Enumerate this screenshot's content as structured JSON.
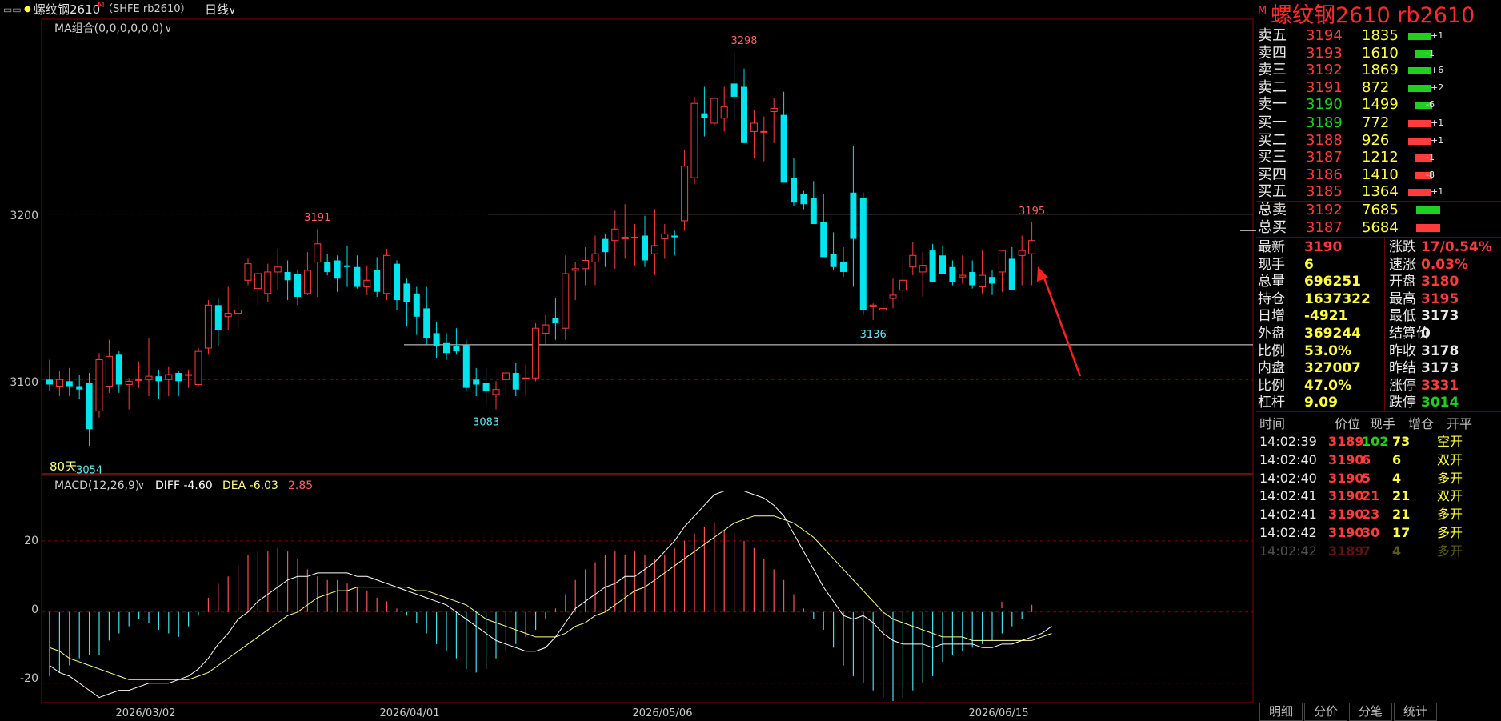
{
  "header": {
    "symbol_name": "螺纹钢2610",
    "m_badge": "M",
    "exchange_code": "（SHFE rb2610）",
    "period": "日线",
    "ma_label": "MA组合(0,0,0,0,0,0)",
    "days_label": "80天"
  },
  "macd": {
    "label": "MACD(12,26,9)",
    "diff": "DIFF -4.60",
    "dea": "DEA -6.03",
    "macd_value": "2.85"
  },
  "colors": {
    "up": "#ff3b3b",
    "down": "#00e5ee",
    "grid": "#8b0000",
    "diff_line": "#ffffff",
    "dea_line": "#ffff90"
  },
  "chart_data": {
    "type": "candlestick",
    "price_axis_ticks": [
      "3200",
      "3100"
    ],
    "price_range": [
      3044,
      3315
    ],
    "macd_axis_ticks": [
      "20",
      "0",
      "-20"
    ],
    "macd_range": [
      -25,
      33
    ],
    "date_labels": [
      "2026/03/02",
      "2026/04/01",
      "2026/05/06",
      "2026/06/15"
    ],
    "annotations": [
      "3191",
      "3298",
      "3195",
      "3083",
      "3136",
      "3054"
    ],
    "support_resistance": [
      3200,
      3121
    ],
    "candles": [
      [
        3100,
        3112,
        3093,
        3097
      ],
      [
        3096,
        3105,
        3090,
        3100
      ],
      [
        3099,
        3107,
        3090,
        3096
      ],
      [
        3096,
        3103,
        3088,
        3094
      ],
      [
        3098,
        3104,
        3060,
        3070
      ],
      [
        3081,
        3116,
        3077,
        3112
      ],
      [
        3096,
        3124,
        3092,
        3114
      ],
      [
        3115,
        3117,
        3092,
        3097
      ],
      [
        3097,
        3101,
        3082,
        3099
      ],
      [
        3100,
        3111,
        3095,
        3100
      ],
      [
        3100,
        3125,
        3090,
        3102
      ],
      [
        3102,
        3106,
        3088,
        3099
      ],
      [
        3100,
        3108,
        3090,
        3103
      ],
      [
        3104,
        3105,
        3090,
        3099
      ],
      [
        3103,
        3106,
        3095,
        3103
      ],
      [
        3097,
        3119,
        3096,
        3117
      ],
      [
        3119,
        3148,
        3115,
        3145
      ],
      [
        3145,
        3149,
        3120,
        3130
      ],
      [
        3138,
        3156,
        3130,
        3140
      ],
      [
        3140,
        3150,
        3131,
        3142
      ],
      [
        3160,
        3173,
        3157,
        3170
      ],
      [
        3155,
        3167,
        3144,
        3164
      ],
      [
        3152,
        3170,
        3147,
        3165
      ],
      [
        3165,
        3179,
        3154,
        3168
      ],
      [
        3165,
        3172,
        3148,
        3160
      ],
      [
        3164,
        3166,
        3145,
        3150
      ],
      [
        3152,
        3177,
        3151,
        3166
      ],
      [
        3171,
        3191,
        3150,
        3182
      ],
      [
        3171,
        3176,
        3163,
        3165
      ],
      [
        3172,
        3175,
        3153,
        3161
      ],
      [
        3169,
        3181,
        3156,
        3168
      ],
      [
        3168,
        3175,
        3155,
        3156
      ],
      [
        3156,
        3169,
        3151,
        3160
      ],
      [
        3166,
        3174,
        3150,
        3153
      ],
      [
        3152,
        3179,
        3148,
        3175
      ],
      [
        3170,
        3172,
        3142,
        3148
      ],
      [
        3158,
        3161,
        3132,
        3147
      ],
      [
        3152,
        3156,
        3127,
        3138
      ],
      [
        3143,
        3156,
        3121,
        3125
      ],
      [
        3128,
        3135,
        3113,
        3120
      ],
      [
        3122,
        3128,
        3112,
        3116
      ],
      [
        3120,
        3131,
        3115,
        3117
      ],
      [
        3121,
        3124,
        3093,
        3095
      ],
      [
        3100,
        3107,
        3090,
        3097
      ],
      [
        3098,
        3107,
        3085,
        3093
      ],
      [
        3091,
        3099,
        3082,
        3094
      ],
      [
        3100,
        3106,
        3090,
        3104
      ],
      [
        3104,
        3110,
        3090,
        3094
      ],
      [
        3101,
        3109,
        3091,
        3101
      ],
      [
        3101,
        3134,
        3099,
        3131
      ],
      [
        3128,
        3139,
        3121,
        3133
      ],
      [
        3137,
        3149,
        3124,
        3134
      ],
      [
        3131,
        3175,
        3124,
        3164
      ],
      [
        3166,
        3171,
        3148,
        3167
      ],
      [
        3167,
        3180,
        3157,
        3172
      ],
      [
        3171,
        3187,
        3157,
        3176
      ],
      [
        3185,
        3188,
        3168,
        3177
      ],
      [
        3184,
        3202,
        3167,
        3191
      ],
      [
        3185,
        3206,
        3173,
        3186
      ],
      [
        3186,
        3194,
        3169,
        3186
      ],
      [
        3187,
        3199,
        3168,
        3172
      ],
      [
        3176,
        3203,
        3163,
        3181
      ],
      [
        3185,
        3194,
        3173,
        3188
      ],
      [
        3187,
        3190,
        3175,
        3186
      ],
      [
        3196,
        3239,
        3190,
        3229
      ],
      [
        3222,
        3271,
        3218,
        3267
      ],
      [
        3261,
        3277,
        3247,
        3258
      ],
      [
        3255,
        3271,
        3253,
        3270
      ],
      [
        3258,
        3277,
        3250,
        3265
      ],
      [
        3279,
        3298,
        3256,
        3271
      ],
      [
        3277,
        3288,
        3245,
        3243
      ],
      [
        3250,
        3263,
        3234,
        3255
      ],
      [
        3250,
        3259,
        3232,
        3250
      ],
      [
        3262,
        3270,
        3243,
        3264
      ],
      [
        3260,
        3274,
        3232,
        3219
      ],
      [
        3222,
        3234,
        3205,
        3207
      ],
      [
        3212,
        3214,
        3203,
        3206
      ],
      [
        3210,
        3220,
        3194,
        3194
      ],
      [
        3195,
        3212,
        3187,
        3174
      ],
      [
        3176,
        3189,
        3166,
        3168
      ],
      [
        3171,
        3180,
        3162,
        3165
      ],
      [
        3213,
        3241,
        3156,
        3185
      ],
      [
        3210,
        3213,
        3139,
        3142
      ],
      [
        3144,
        3146,
        3136,
        3145
      ],
      [
        3142,
        3149,
        3138,
        3143
      ],
      [
        3149,
        3161,
        3143,
        3151
      ],
      [
        3154,
        3173,
        3147,
        3160
      ],
      [
        3168,
        3183,
        3163,
        3175
      ],
      [
        3165,
        3177,
        3150,
        3169
      ],
      [
        3178,
        3182,
        3159,
        3159
      ],
      [
        3175,
        3181,
        3164,
        3164
      ],
      [
        3168,
        3172,
        3157,
        3159
      ],
      [
        3162,
        3175,
        3158,
        3163
      ],
      [
        3165,
        3172,
        3155,
        3157
      ],
      [
        3156,
        3178,
        3152,
        3163
      ],
      [
        3162,
        3166,
        3151,
        3158
      ],
      [
        3165,
        3178,
        3153,
        3178
      ],
      [
        3173,
        3180,
        3158,
        3154
      ],
      [
        3175,
        3187,
        3157,
        3178
      ],
      [
        3176,
        3195,
        3157,
        3184
      ]
    ],
    "macd_hist": [
      -18,
      -17,
      -15,
      -13,
      -12,
      -12,
      -8,
      -6,
      -4,
      -2,
      -3,
      -5,
      -6,
      -7,
      -4,
      -1,
      4,
      8,
      10,
      13,
      16,
      17,
      17,
      18,
      17,
      15,
      12,
      10,
      9,
      9,
      8,
      7,
      6,
      4,
      3,
      1,
      -1,
      -3,
      -6,
      -9,
      -11,
      -13,
      -16,
      -17,
      -16,
      -13,
      -11,
      -9,
      -7,
      -5,
      -2,
      1,
      5,
      9,
      12,
      14,
      16,
      17,
      16,
      17,
      16,
      15,
      16,
      18,
      20,
      22,
      24,
      25,
      23,
      22,
      20,
      18,
      15,
      12,
      9,
      5,
      1,
      -2,
      -5,
      -10,
      -15,
      -18,
      -20,
      -22,
      -24,
      -25,
      -24,
      -22,
      -20,
      -18,
      -14,
      -12,
      -11,
      -10,
      -9,
      -8,
      -6,
      -4,
      -2,
      2
    ],
    "diff_line": [
      -15,
      -17,
      -18,
      -20,
      -22,
      -24,
      -23,
      -22,
      -22,
      -21,
      -20,
      -20,
      -20,
      -19,
      -18,
      -16,
      -13,
      -9,
      -6,
      -2,
      0,
      3,
      5,
      7,
      9,
      10,
      10,
      11,
      11,
      11,
      11,
      10,
      10,
      9,
      8,
      7,
      6,
      5,
      4,
      3,
      2,
      0,
      -2,
      -4,
      -6,
      -8,
      -9,
      -10,
      -11,
      -11,
      -10,
      -7,
      -3,
      1,
      3,
      5,
      7,
      8,
      10,
      10,
      12,
      14,
      17,
      20,
      24,
      27,
      30,
      33,
      34,
      34,
      34,
      33,
      32,
      30,
      27,
      22,
      17,
      12,
      7,
      3,
      -1,
      -2,
      -1,
      -3,
      -6,
      -8,
      -9,
      -9,
      -9,
      -10,
      -9,
      -9,
      -9,
      -9,
      -10,
      -10,
      -9,
      -9,
      -8,
      -7,
      -6,
      -4
    ],
    "dea_line": [
      -10,
      -11,
      -13,
      -14,
      -15,
      -16,
      -17,
      -18,
      -19,
      -19,
      -19,
      -19,
      -19,
      -19,
      -19,
      -18,
      -17,
      -15,
      -13,
      -11,
      -9,
      -7,
      -5,
      -3,
      -1,
      0,
      2,
      4,
      5,
      6,
      6,
      7,
      7,
      7,
      7,
      7,
      7,
      6,
      6,
      5,
      4,
      3,
      2,
      0,
      -2,
      -3,
      -4,
      -5,
      -6,
      -7,
      -7,
      -7,
      -6,
      -4,
      -3,
      -1,
      0,
      2,
      4,
      6,
      7,
      9,
      11,
      13,
      15,
      17,
      19,
      21,
      23,
      25,
      26,
      27,
      27,
      27,
      26,
      25,
      23,
      21,
      18,
      15,
      12,
      9,
      6,
      3,
      0,
      -2,
      -3,
      -4,
      -5,
      -6,
      -7,
      -7,
      -7,
      -8,
      -8,
      -8,
      -8,
      -8,
      -8,
      -8,
      -7,
      -6
    ]
  },
  "right_panel": {
    "title": "螺纹钢2610  rb2610",
    "m_badge": "M",
    "asks": [
      {
        "label": "卖五",
        "price": "3194",
        "vol": "1835",
        "chg": "+1",
        "up": true
      },
      {
        "label": "卖四",
        "price": "3193",
        "vol": "1610",
        "chg": "-1",
        "up": false
      },
      {
        "label": "卖三",
        "price": "3192",
        "vol": "1869",
        "chg": "+6",
        "up": true
      },
      {
        "label": "卖二",
        "price": "3191",
        "vol": "872",
        "chg": "+2",
        "up": true
      },
      {
        "label": "卖一",
        "price": "3190",
        "vol": "1499",
        "chg": "-6",
        "up": false
      }
    ],
    "bids": [
      {
        "label": "买一",
        "price": "3189",
        "vol": "772",
        "chg": "+1",
        "up": true
      },
      {
        "label": "买二",
        "price": "3188",
        "vol": "926",
        "chg": "+1",
        "up": true
      },
      {
        "label": "买三",
        "price": "3187",
        "vol": "1212",
        "chg": "-1",
        "up": false
      },
      {
        "label": "买四",
        "price": "3186",
        "vol": "1410",
        "chg": "-8",
        "up": false
      },
      {
        "label": "买五",
        "price": "3185",
        "vol": "1364",
        "chg": "+1",
        "up": true
      }
    ],
    "totals": [
      {
        "label": "总卖",
        "price": "3192",
        "vol": "7685"
      },
      {
        "label": "总买",
        "price": "3187",
        "vol": "5684"
      }
    ],
    "quote": [
      {
        "l1": "最新",
        "v1": "3190",
        "c1": "red",
        "l2": "涨跌",
        "v2": "17/0.54%",
        "c2": "red"
      },
      {
        "l1": "现手",
        "v1": "6",
        "c1": "yellow",
        "l2": "速涨",
        "v2": "0.03%",
        "c2": "red"
      },
      {
        "l1": "总量",
        "v1": "696251",
        "c1": "yellow",
        "l2": "开盘",
        "v2": "3180",
        "c2": "red"
      },
      {
        "l1": "持仓",
        "v1": "1637322",
        "c1": "yellow",
        "l2": "最高",
        "v2": "3195",
        "c2": "red"
      },
      {
        "l1": "日增",
        "v1": "-4921",
        "c1": "yellow",
        "l2": "最低",
        "v2": "3173",
        "c2": "white"
      },
      {
        "l1": "外盘",
        "v1": "369244",
        "c1": "yellow",
        "l2": "结算价",
        "v2": "0",
        "c2": "white"
      },
      {
        "l1": "比例",
        "v1": "53.0%",
        "c1": "yellow",
        "l2": "昨收",
        "v2": "3178",
        "c2": "white"
      },
      {
        "l1": "内盘",
        "v1": "327007",
        "c1": "yellow",
        "l2": "昨结",
        "v2": "3173",
        "c2": "white"
      },
      {
        "l1": "比例",
        "v1": "47.0%",
        "c1": "yellow",
        "l2": "涨停",
        "v2": "3331",
        "c2": "red"
      },
      {
        "l1": "杠杆",
        "v1": "9.09",
        "c1": "yellow",
        "l2": "跌停",
        "v2": "3014",
        "c2": "green"
      }
    ],
    "ticks_header": [
      "时间",
      "价位",
      "现手",
      "增仓",
      "开平"
    ],
    "ticks": [
      {
        "time": "14:02:39",
        "price": "3189",
        "vol": "102",
        "vc": "green",
        "oi": "73",
        "type": "空开"
      },
      {
        "time": "14:02:40",
        "price": "3190",
        "vol": "6",
        "vc": "red",
        "oi": "6",
        "type": "双开"
      },
      {
        "time": "14:02:40",
        "price": "3190",
        "vol": "5",
        "vc": "red",
        "oi": "4",
        "type": "多开"
      },
      {
        "time": "14:02:41",
        "price": "3190",
        "vol": "21",
        "vc": "red",
        "oi": "21",
        "type": "双开"
      },
      {
        "time": "14:02:41",
        "price": "3190",
        "vol": "23",
        "vc": "red",
        "oi": "21",
        "type": "多开"
      },
      {
        "time": "14:02:42",
        "price": "3190",
        "vol": "30",
        "vc": "red",
        "oi": "17",
        "type": "多开"
      },
      {
        "time": "14:02:42",
        "price": "3189",
        "vol": "7",
        "vc": "red",
        "oi": "4",
        "type": "多开"
      }
    ],
    "tabs": [
      "明细",
      "分价",
      "分笔",
      "统计"
    ]
  }
}
